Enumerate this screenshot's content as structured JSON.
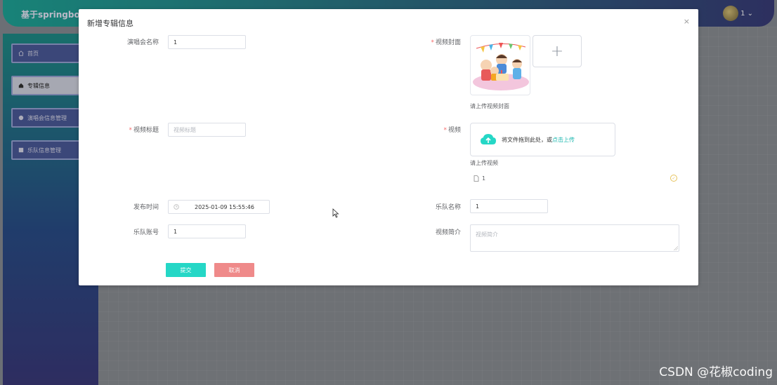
{
  "app": {
    "title": "基于springboot",
    "user": "1 ⌄"
  },
  "sidebar": {
    "items": [
      {
        "label": "首页",
        "icon": "home-icon"
      },
      {
        "label": "专辑信息",
        "icon": "album-icon",
        "active": true
      },
      {
        "label": "演唱会信息管理",
        "icon": "concert-icon"
      },
      {
        "label": "乐队信息管理",
        "icon": "band-icon"
      }
    ]
  },
  "dialog": {
    "title": "新增专辑信息",
    "close": "×",
    "fields": {
      "concert_name": {
        "label": "演唱会名称",
        "value": "1"
      },
      "video_cover": {
        "label": "视频封面",
        "required": true,
        "tip": "请上传视频封面",
        "add": "+"
      },
      "video_title": {
        "label": "视频标题",
        "required": true,
        "placeholder": "视频标题"
      },
      "video": {
        "label": "视频",
        "required": true,
        "drop_text": "将文件拖到此处，或",
        "drop_link": "点击上传",
        "tip": "请上传视频",
        "file_name": "1"
      },
      "publish_time": {
        "label": "发布时间",
        "value": "2025-01-09 15:55:46"
      },
      "band_name": {
        "label": "乐队名称",
        "value": "1"
      },
      "band_account": {
        "label": "乐队账号",
        "value": "1"
      },
      "video_intro": {
        "label": "视频简介",
        "placeholder": "视频简介"
      }
    },
    "buttons": {
      "submit": "提交",
      "cancel": "取消"
    }
  },
  "watermark": "CSDN @花椒coding",
  "colors": {
    "accent": "#25d7c6",
    "cancel": "#ef8a8a",
    "required": "#f56c6c"
  }
}
